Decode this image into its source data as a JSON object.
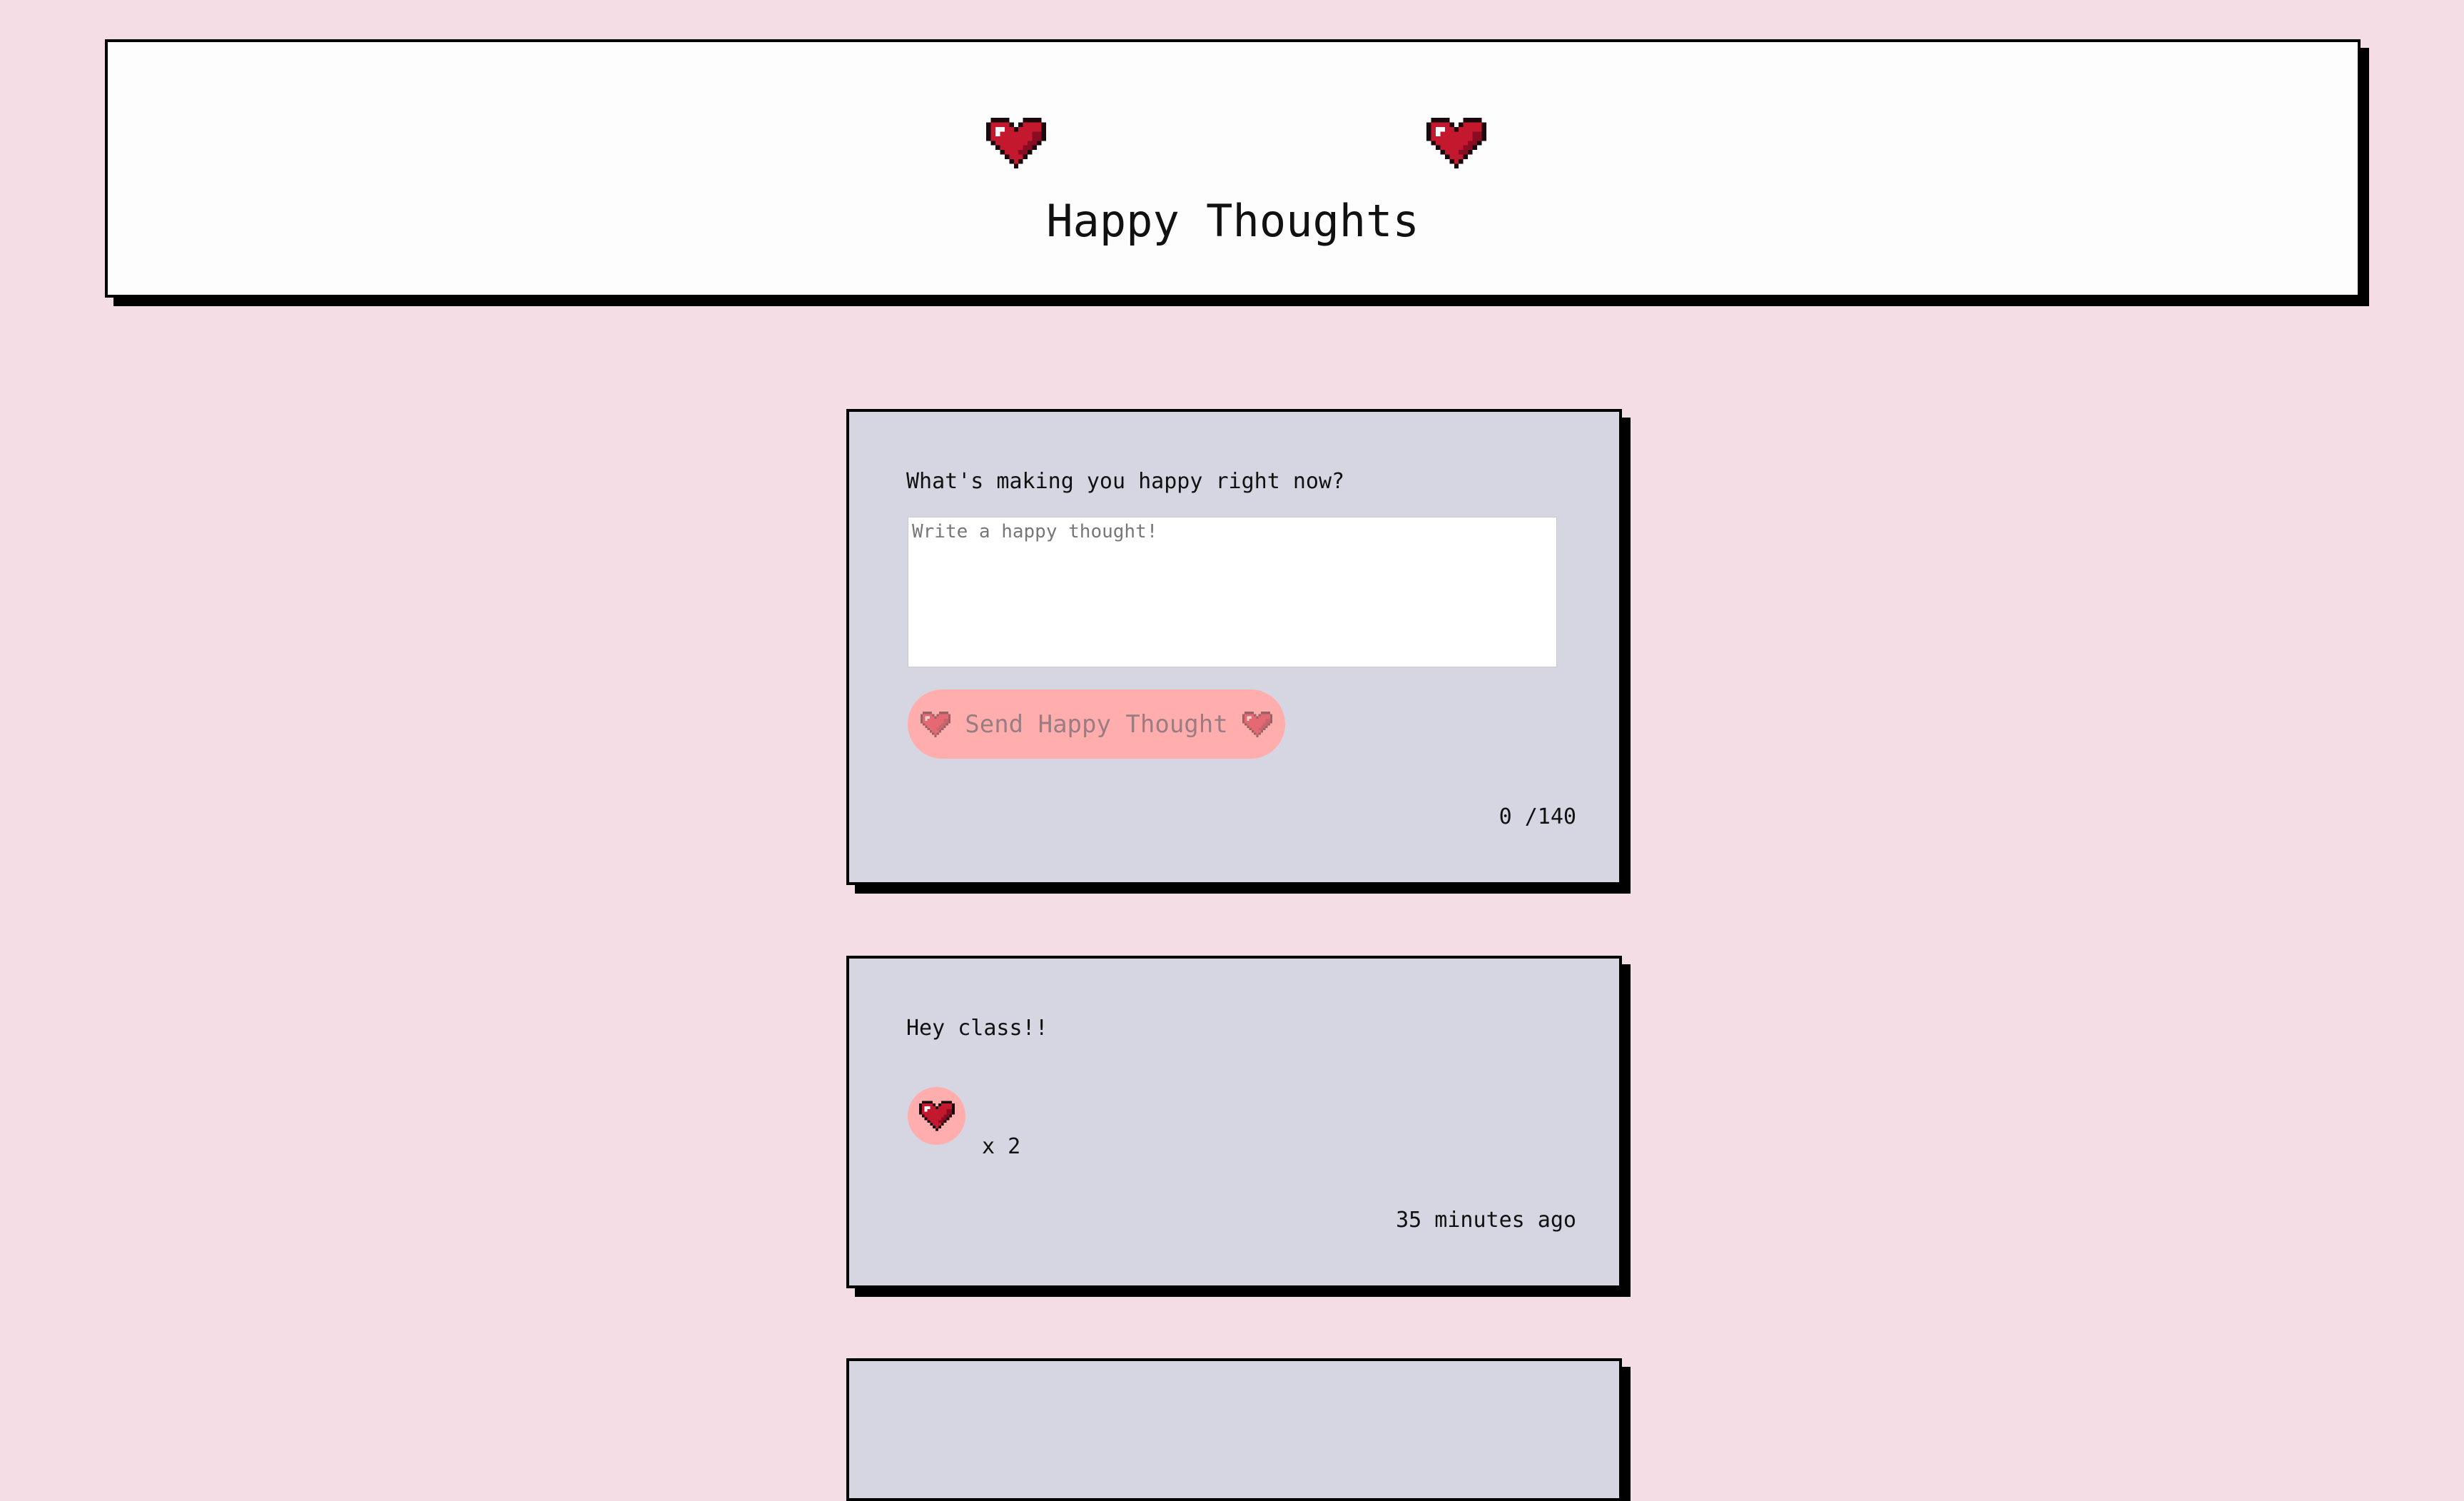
{
  "header": {
    "title": "Happy Thoughts",
    "heart_icon": "pixel-heart-icon",
    "heart_color": "#b5122f"
  },
  "form": {
    "prompt": "What's making you happy right now?",
    "placeholder": "Write a happy thought!",
    "value": "",
    "send_label": "Send Happy Thought",
    "char_count": "0 /140",
    "button_color": "#ffadad"
  },
  "thoughts": [
    {
      "message": "Hey class!!",
      "likes": "x 2",
      "time": "35 minutes ago"
    }
  ],
  "colors": {
    "background": "#f5dde5",
    "card": "#d5d6e1",
    "header": "#fefdfe"
  }
}
